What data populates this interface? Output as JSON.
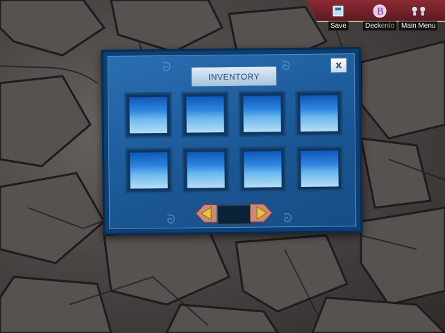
{
  "toolbar": {
    "save_label": "Save",
    "deck_label": "Deck",
    "main_menu_label": "Main Menu",
    "overlap_text": "ento"
  },
  "inventory": {
    "title": "INVENTORY",
    "close_label": "x",
    "slot_rows": 2,
    "slot_cols": 4
  },
  "colors": {
    "panel": "#1b5896",
    "banner": "#8c2a33",
    "slot_glow": "#2f86e0",
    "arrow": "#e8c53a"
  },
  "icons": [
    "save-icon",
    "deck-icon",
    "main-menu-icon",
    "close-icon",
    "arrow-left-icon",
    "arrow-right-icon"
  ]
}
